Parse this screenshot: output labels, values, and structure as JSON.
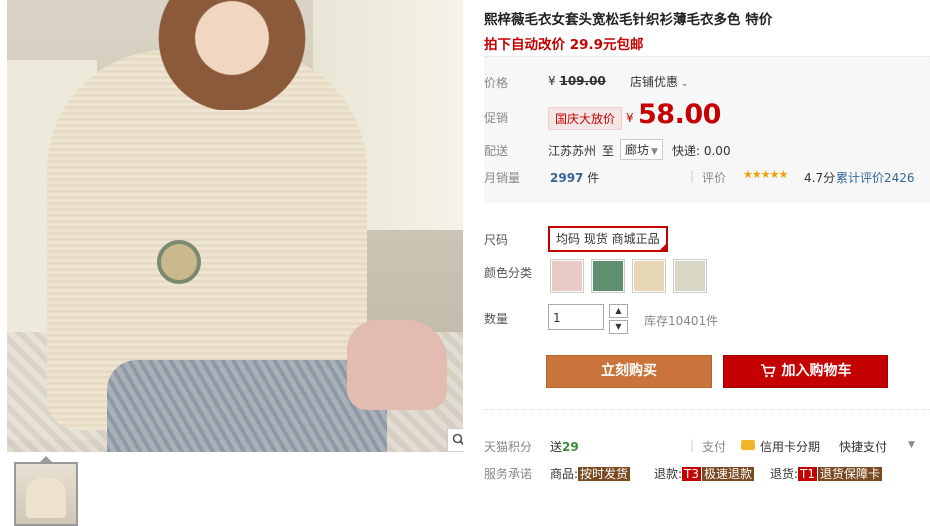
{
  "product": {
    "title": "熙梓薇毛衣女套头宽松毛针织衫薄毛衣多色 特价",
    "subtitle": "拍下自动改价 29.9元包邮"
  },
  "price": {
    "label": "价格",
    "old_prefix": "¥",
    "old_value": "109.00",
    "shop_discount": "店铺优惠"
  },
  "promo": {
    "label": "促销",
    "tag": "国庆大放价",
    "yen": "¥",
    "value": "58.00"
  },
  "shipping": {
    "label": "配送",
    "from": "江苏苏州",
    "to_word": "至",
    "destination": "廊坊",
    "express": "快递: 0.00"
  },
  "sales": {
    "label": "月销量",
    "count": "2997",
    "unit": "件",
    "review_label": "评价",
    "stars_glyph": "★★★★★",
    "score": "4.7分",
    "reviews": "累计评价2426"
  },
  "size": {
    "label": "尺码",
    "option": "均码 现货 商城正品"
  },
  "color": {
    "label": "颜色分类",
    "swatches": [
      "#e9c9c4",
      "#5f8f6e",
      "#e7d6b6",
      "#d8d6c4"
    ]
  },
  "quantity": {
    "label": "数量",
    "value": "1",
    "stock": "库存10401件"
  },
  "actions": {
    "buy": "立刻购买",
    "cart": "加入购物车"
  },
  "points": {
    "label": "天猫积分",
    "text": "送",
    "value": "29"
  },
  "payment": {
    "label": "支付",
    "card": "信用卡分期",
    "fast": "快捷支付"
  },
  "service": {
    "label": "服务承诺",
    "goods_prefix": "商品:",
    "goods_tag": "按时发货",
    "refund_prefix": "退款:",
    "refund_t": "T3",
    "refund_tag": "极速退款",
    "return_prefix": "退货:",
    "return_t": "T1",
    "return_tag": "退货保障卡"
  }
}
